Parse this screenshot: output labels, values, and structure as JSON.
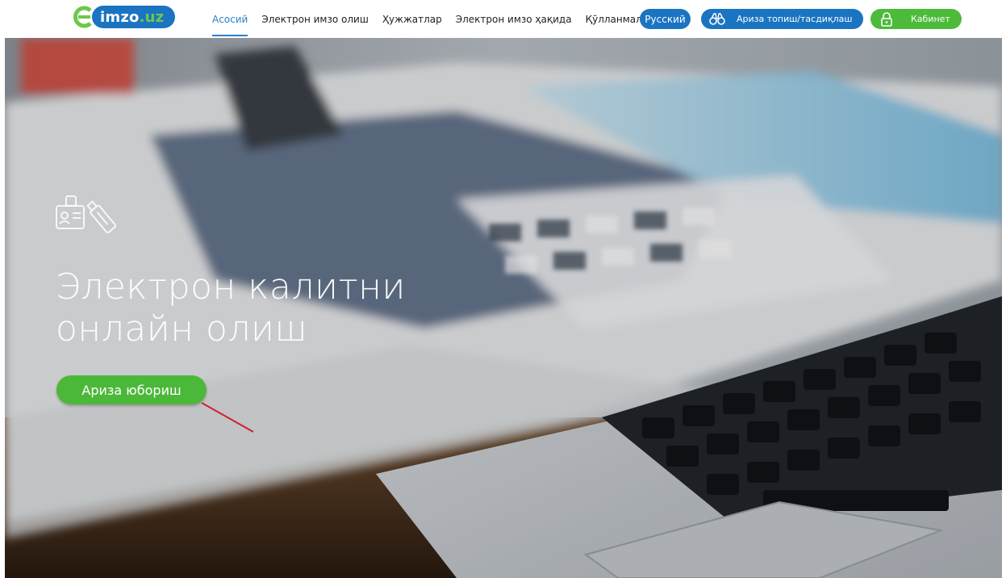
{
  "header": {
    "logo": {
      "text": "imzo",
      "suffix": ".uz"
    },
    "nav": [
      {
        "label": "Асосий",
        "active": true
      },
      {
        "label": "Электрон имзо олиш",
        "active": false
      },
      {
        "label": "Ҳужжатлар",
        "active": false
      },
      {
        "label": "Электрон имзо ҳақида",
        "active": false
      },
      {
        "label": "Қўлланмалар",
        "active": false
      }
    ],
    "lang_button": "Русский",
    "find_button": {
      "icon": "binoculars-icon",
      "label": "Ариза топиш/тасдиқлаш"
    },
    "cabinet_button": {
      "icon": "lock-icon",
      "label": "Кабинет"
    }
  },
  "hero": {
    "icon": "id-card-usb-key-icon",
    "title_line1": "Электрон калитни",
    "title_line2": "онлайн олиш",
    "cta_label": "Ариза юбориш"
  },
  "colors": {
    "brand_blue": "#1a74c2",
    "brand_green": "#4cbb3a",
    "active_link": "#2b82c9",
    "annotation_arrow": "#d0202a"
  }
}
